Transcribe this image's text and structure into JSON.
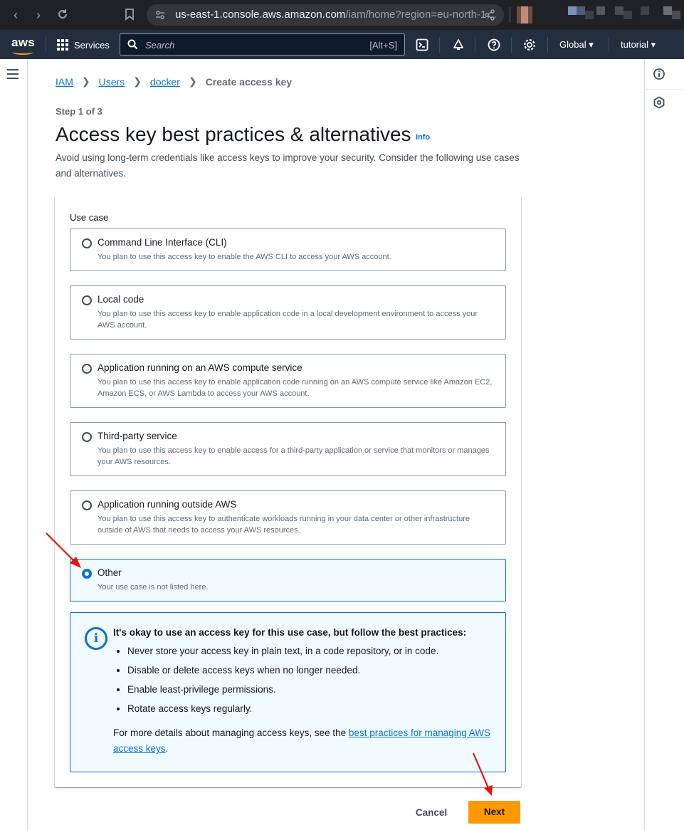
{
  "browser": {
    "url_host": "us-east-1.console.aws.amazon.com",
    "url_path": "/iam/home?region=eu-north-1…"
  },
  "topnav": {
    "logo": "aws",
    "services_label": "Services",
    "search_placeholder": "Search",
    "search_shortcut": "[Alt+S]",
    "region_label": "Global",
    "account_label": "tutorial"
  },
  "breadcrumb": {
    "items": [
      "IAM",
      "Users",
      "docker"
    ],
    "current": "Create access key"
  },
  "page": {
    "step": "Step 1 of 3",
    "title": "Access key best practices & alternatives",
    "info_link": "Info",
    "description": "Avoid using long-term credentials like access keys to improve your security. Consider the following use cases and alternatives."
  },
  "use_case": {
    "label": "Use case",
    "selected_index": 5,
    "options": [
      {
        "title": "Command Line Interface (CLI)",
        "description": "You plan to use this access key to enable the AWS CLI to access your AWS account."
      },
      {
        "title": "Local code",
        "description": "You plan to use this access key to enable application code in a local development environment to access your AWS account."
      },
      {
        "title": "Application running on an AWS compute service",
        "description": "You plan to use this access key to enable application code running on an AWS compute service like Amazon EC2, Amazon ECS, or AWS Lambda to access your AWS account."
      },
      {
        "title": "Third-party service",
        "description": "You plan to use this access key to enable access for a third-party application or service that monitors or manages your AWS resources."
      },
      {
        "title": "Application running outside AWS",
        "description": "You plan to use this access key to authenticate workloads running in your data center or other infrastructure outside of AWS that needs to access your AWS resources."
      },
      {
        "title": "Other",
        "description": "Your use case is not listed here."
      }
    ]
  },
  "alert": {
    "title": "It's okay to use an access key for this use case, but follow the best practices:",
    "items": [
      "Never store your access key in plain text, in a code repository, or in code.",
      "Disable or delete access keys when no longer needed.",
      "Enable least-privilege permissions.",
      "Rotate access keys regularly."
    ],
    "footer_prefix": "For more details about managing access keys, see the ",
    "footer_link": "best practices for managing AWS access keys",
    "footer_suffix": "."
  },
  "actions": {
    "cancel": "Cancel",
    "next": "Next"
  },
  "colors": {
    "accent": "#0972d3",
    "primary_button": "#ff9900",
    "nav_bg": "#232f3e",
    "annotation_arrow": "#e8140c"
  }
}
